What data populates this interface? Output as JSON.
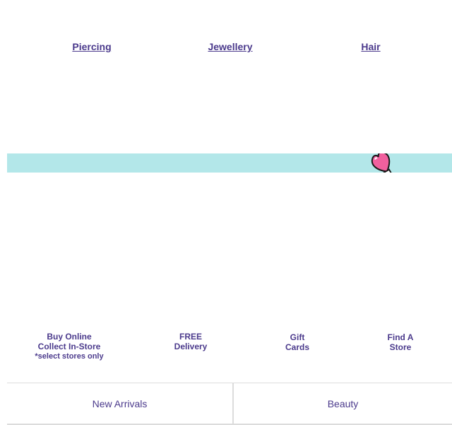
{
  "categories": [
    {
      "label": "Piercing"
    },
    {
      "label": "Jewellery"
    },
    {
      "label": "Hair"
    }
  ],
  "banner": {
    "background": "#b3e7e9",
    "icon": "heart-wand-icon"
  },
  "features": [
    {
      "lines": [
        "Buy Online",
        "Collect In-Store"
      ],
      "note": "*select stores only"
    },
    {
      "lines": [
        "FREE",
        "Delivery"
      ]
    },
    {
      "lines": [
        "Gift",
        "Cards"
      ]
    },
    {
      "lines": [
        "Find A",
        "Store"
      ]
    }
  ],
  "bottom_nav": [
    {
      "label": "New Arrivals"
    },
    {
      "label": "Beauty"
    }
  ],
  "colors": {
    "accent": "#4b3a8c",
    "divider": "#dcdcdc",
    "heart": "#f0609e"
  }
}
